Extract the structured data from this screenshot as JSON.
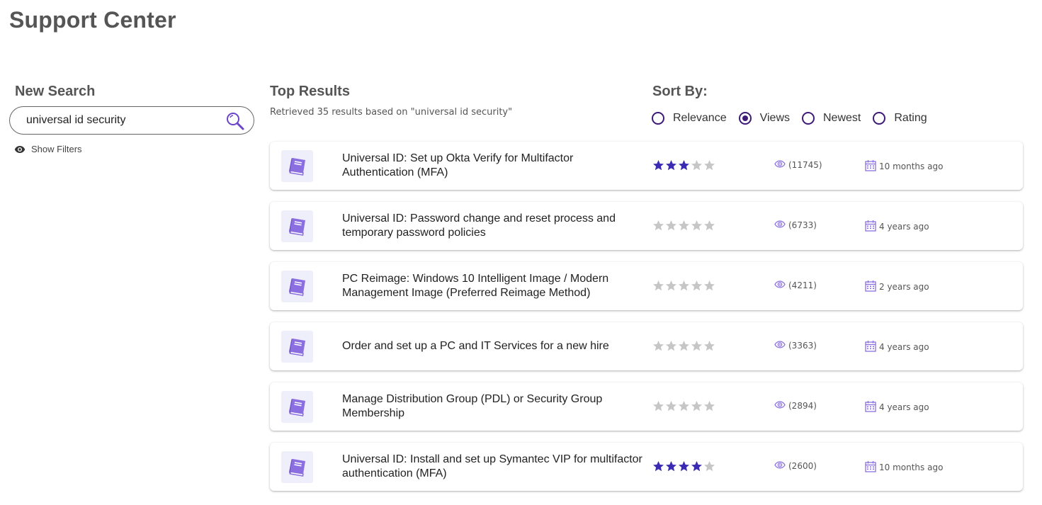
{
  "page": {
    "title": "Support Center"
  },
  "search": {
    "heading": "New Search",
    "value": "universal id security",
    "show_filters_label": "Show Filters"
  },
  "results": {
    "heading": "Top Results",
    "summary": "Retrieved 35 results based on \"universal id security\"",
    "items": [
      {
        "title": "Universal ID: Set up Okta Verify for Multifactor Authentication (MFA)",
        "rating": 3,
        "views": "(11745)",
        "age": "10 months ago"
      },
      {
        "title": "Universal ID: Password change and reset process and temporary password policies",
        "rating": 0,
        "views": "(6733)",
        "age": "4 years ago"
      },
      {
        "title": "PC Reimage: Windows 10 Intelligent Image / Modern Management Image (Preferred Reimage Method)",
        "rating": 0,
        "views": "(4211)",
        "age": "2 years ago"
      },
      {
        "title": "Order and set up a PC and IT Services for a new hire",
        "rating": 0,
        "views": "(3363)",
        "age": "4 years ago"
      },
      {
        "title": "Manage Distribution Group (PDL) or Security Group Membership",
        "rating": 0,
        "views": "(2894)",
        "age": "4 years ago"
      },
      {
        "title": "Universal ID: Install and set up Symantec VIP for multifactor authentication (MFA)",
        "rating": 4,
        "views": "(2600)",
        "age": "10 months ago"
      }
    ]
  },
  "sort": {
    "heading": "Sort By:",
    "options": [
      "Relevance",
      "Views",
      "Newest",
      "Rating"
    ],
    "selected": "Views"
  },
  "colors": {
    "accent": "#3d1a78",
    "star_filled": "#3b2bb0",
    "star_empty": "#c6c6c6",
    "icon_purple": "#8b6fe0",
    "tile_bg": "#efeefb"
  },
  "icons": {
    "search": "magnifier-icon",
    "show_filters": "eye-icon",
    "result": "book-icon",
    "views": "eye-outline-icon",
    "date": "calendar-icon",
    "rating": "star-icon"
  }
}
